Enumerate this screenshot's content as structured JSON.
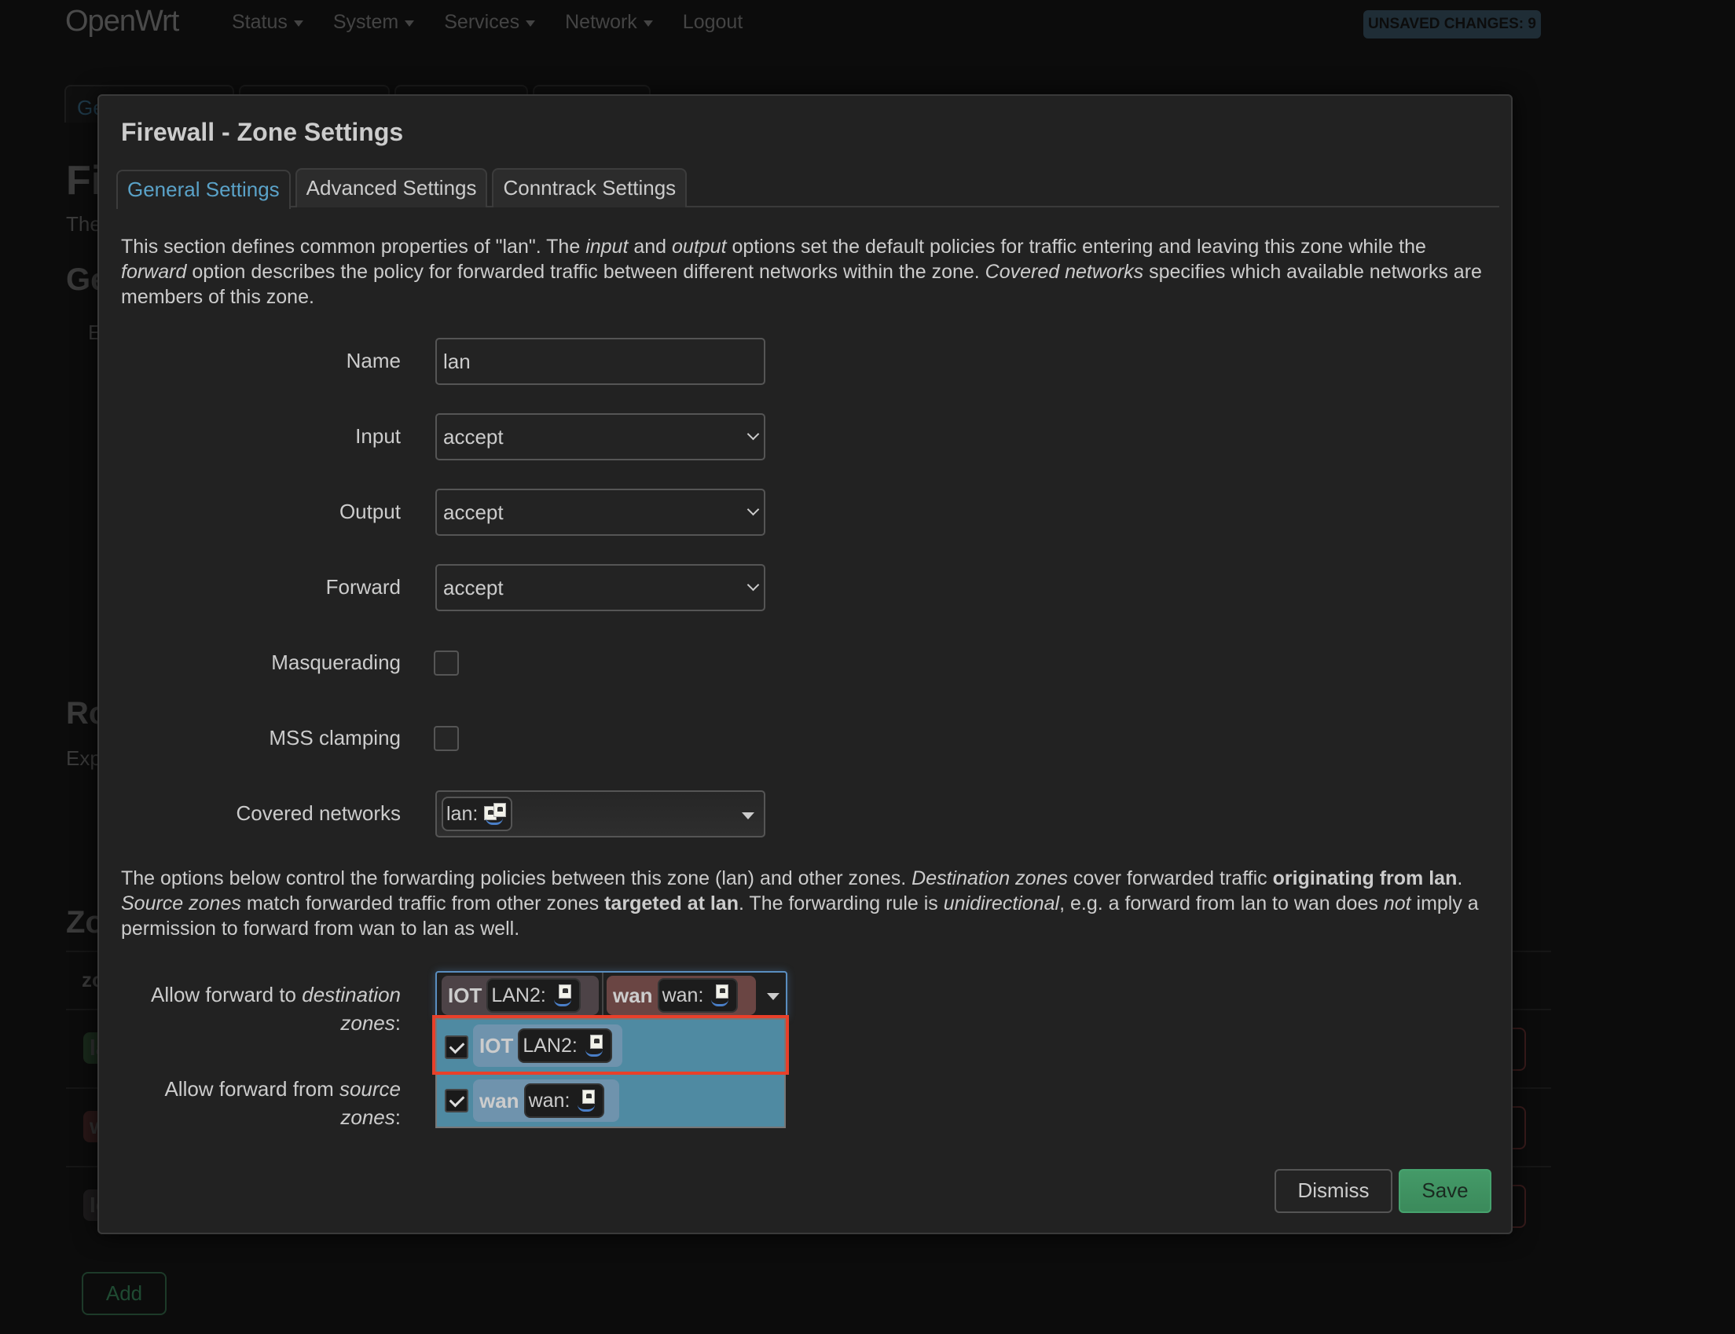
{
  "app": {
    "brand": "OpenWrt",
    "nav": [
      "Status",
      "System",
      "Services",
      "Network",
      "Logout"
    ],
    "unsaved_badge": "UNSAVED CHANGES: 9"
  },
  "background_page": {
    "active_tab_fragment": "Ge",
    "title_fragment": "Fi",
    "intro_fragment": "The",
    "section1_fragment": "Ge",
    "item_fragment": "E",
    "section2_fragment": "Ro",
    "section2_desc_fragment": "Exp",
    "section3_fragment": "Zo",
    "table_header_fragment": "zo",
    "zone_rows": [
      {
        "fragment": "la",
        "color": "#1f3a24"
      },
      {
        "fragment": "w",
        "color": "#3a1f1f"
      },
      {
        "fragment": "Io",
        "color": "#2a2627"
      }
    ],
    "add_button": "Add"
  },
  "modal": {
    "title": "Firewall - Zone Settings",
    "tabs": [
      {
        "label": "General Settings",
        "active": true
      },
      {
        "label": "Advanced Settings",
        "active": false
      },
      {
        "label": "Conntrack Settings",
        "active": false
      }
    ],
    "description": {
      "p1": "This section defines common properties of \"lan\". The ",
      "p1_i1": "input",
      "p1_t2": " and ",
      "p1_i2": "output",
      "p1_t3": " options set the default policies for traffic entering and leaving this zone while the ",
      "p1_i3": "forward",
      "p1_t4": " option describes the policy for forwarded traffic between different networks within the zone. ",
      "p1_i4": "Covered networks",
      "p1_t5": " specifies which available networks are members of this zone."
    },
    "fields": {
      "name": {
        "label": "Name",
        "value": "lan"
      },
      "input": {
        "label": "Input",
        "value": "accept"
      },
      "output": {
        "label": "Output",
        "value": "accept"
      },
      "forward": {
        "label": "Forward",
        "value": "accept"
      },
      "masquerading": {
        "label": "Masquerading",
        "checked": false
      },
      "mss_clamping": {
        "label": "MSS clamping",
        "checked": false
      },
      "covered_networks": {
        "label": "Covered networks",
        "value": "lan:",
        "icon": "network-bridge-icon"
      }
    },
    "forwarding_description": {
      "t1": "The options below control the forwarding policies between this zone (lan) and other zones. ",
      "i1": "Destination zones",
      "t2": " cover forwarded traffic ",
      "b1": "originating from lan",
      "t3": ". ",
      "i2": "Source zones",
      "t4": " match forwarded traffic from other zones ",
      "b2": "targeted at lan",
      "t5": ". The forwarding rule is ",
      "i3": "unidirectional",
      "t6": ", e.g. a forward from lan to wan does ",
      "i4": "not",
      "t7": " imply a permission to forward from wan to lan as well."
    },
    "dest_zones": {
      "label_pre": "Allow forward to ",
      "label_i": "destination",
      "label_i2": "zones",
      "label_post": ":",
      "selected": [
        {
          "zone": "IOT",
          "network": "LAN2:",
          "color": "#4d4347"
        },
        {
          "zone": "wan",
          "network": "wan:",
          "color": "#6a4543"
        }
      ],
      "options": [
        {
          "zone": "IOT",
          "network": "LAN2:",
          "checked": true
        },
        {
          "zone": "wan",
          "network": "wan:",
          "checked": true
        }
      ]
    },
    "src_zones": {
      "label_pre": "Allow forward from ",
      "label_i": "source",
      "label_i2": "zones",
      "label_post": ":"
    },
    "buttons": {
      "dismiss": "Dismiss",
      "save": "Save"
    }
  },
  "colors": {
    "accent": "#5aa2c8",
    "save_green": "#449a68",
    "dropdown_bg": "#4f8aa2",
    "highlight_red": "#e8402a"
  }
}
